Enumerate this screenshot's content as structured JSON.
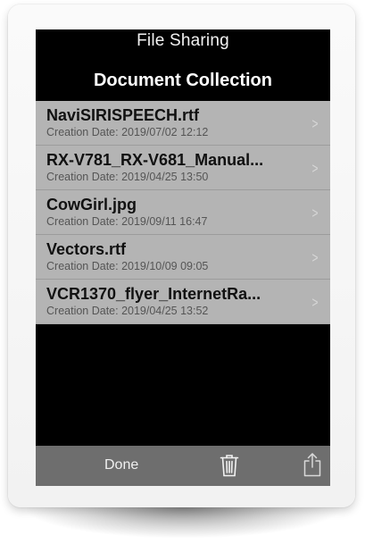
{
  "nav": {
    "title": "File Sharing"
  },
  "collection": {
    "title": "Document Collection"
  },
  "files": [
    {
      "name": "NaviSIRISPEECH.rtf",
      "date": "Creation Date: 2019/07/02 12:12"
    },
    {
      "name": "RX-V781_RX-V681_Manual...",
      "date": "Creation Date: 2019/04/25 13:50"
    },
    {
      "name": "CowGirl.jpg",
      "date": "Creation Date: 2019/09/11 16:47"
    },
    {
      "name": "Vectors.rtf",
      "date": "Creation Date: 2019/10/09 09:05"
    },
    {
      "name": "VCR1370_flyer_InternetRa...",
      "date": "Creation Date: 2019/04/25 13:52"
    }
  ],
  "toolbar": {
    "done_label": "Done",
    "trash_icon": "trash-icon",
    "share_icon": "share-icon"
  },
  "colors": {
    "screen_bg": "#000000",
    "list_bg": "#b4b4b4",
    "toolbar_bg": "#6e6e6e"
  }
}
